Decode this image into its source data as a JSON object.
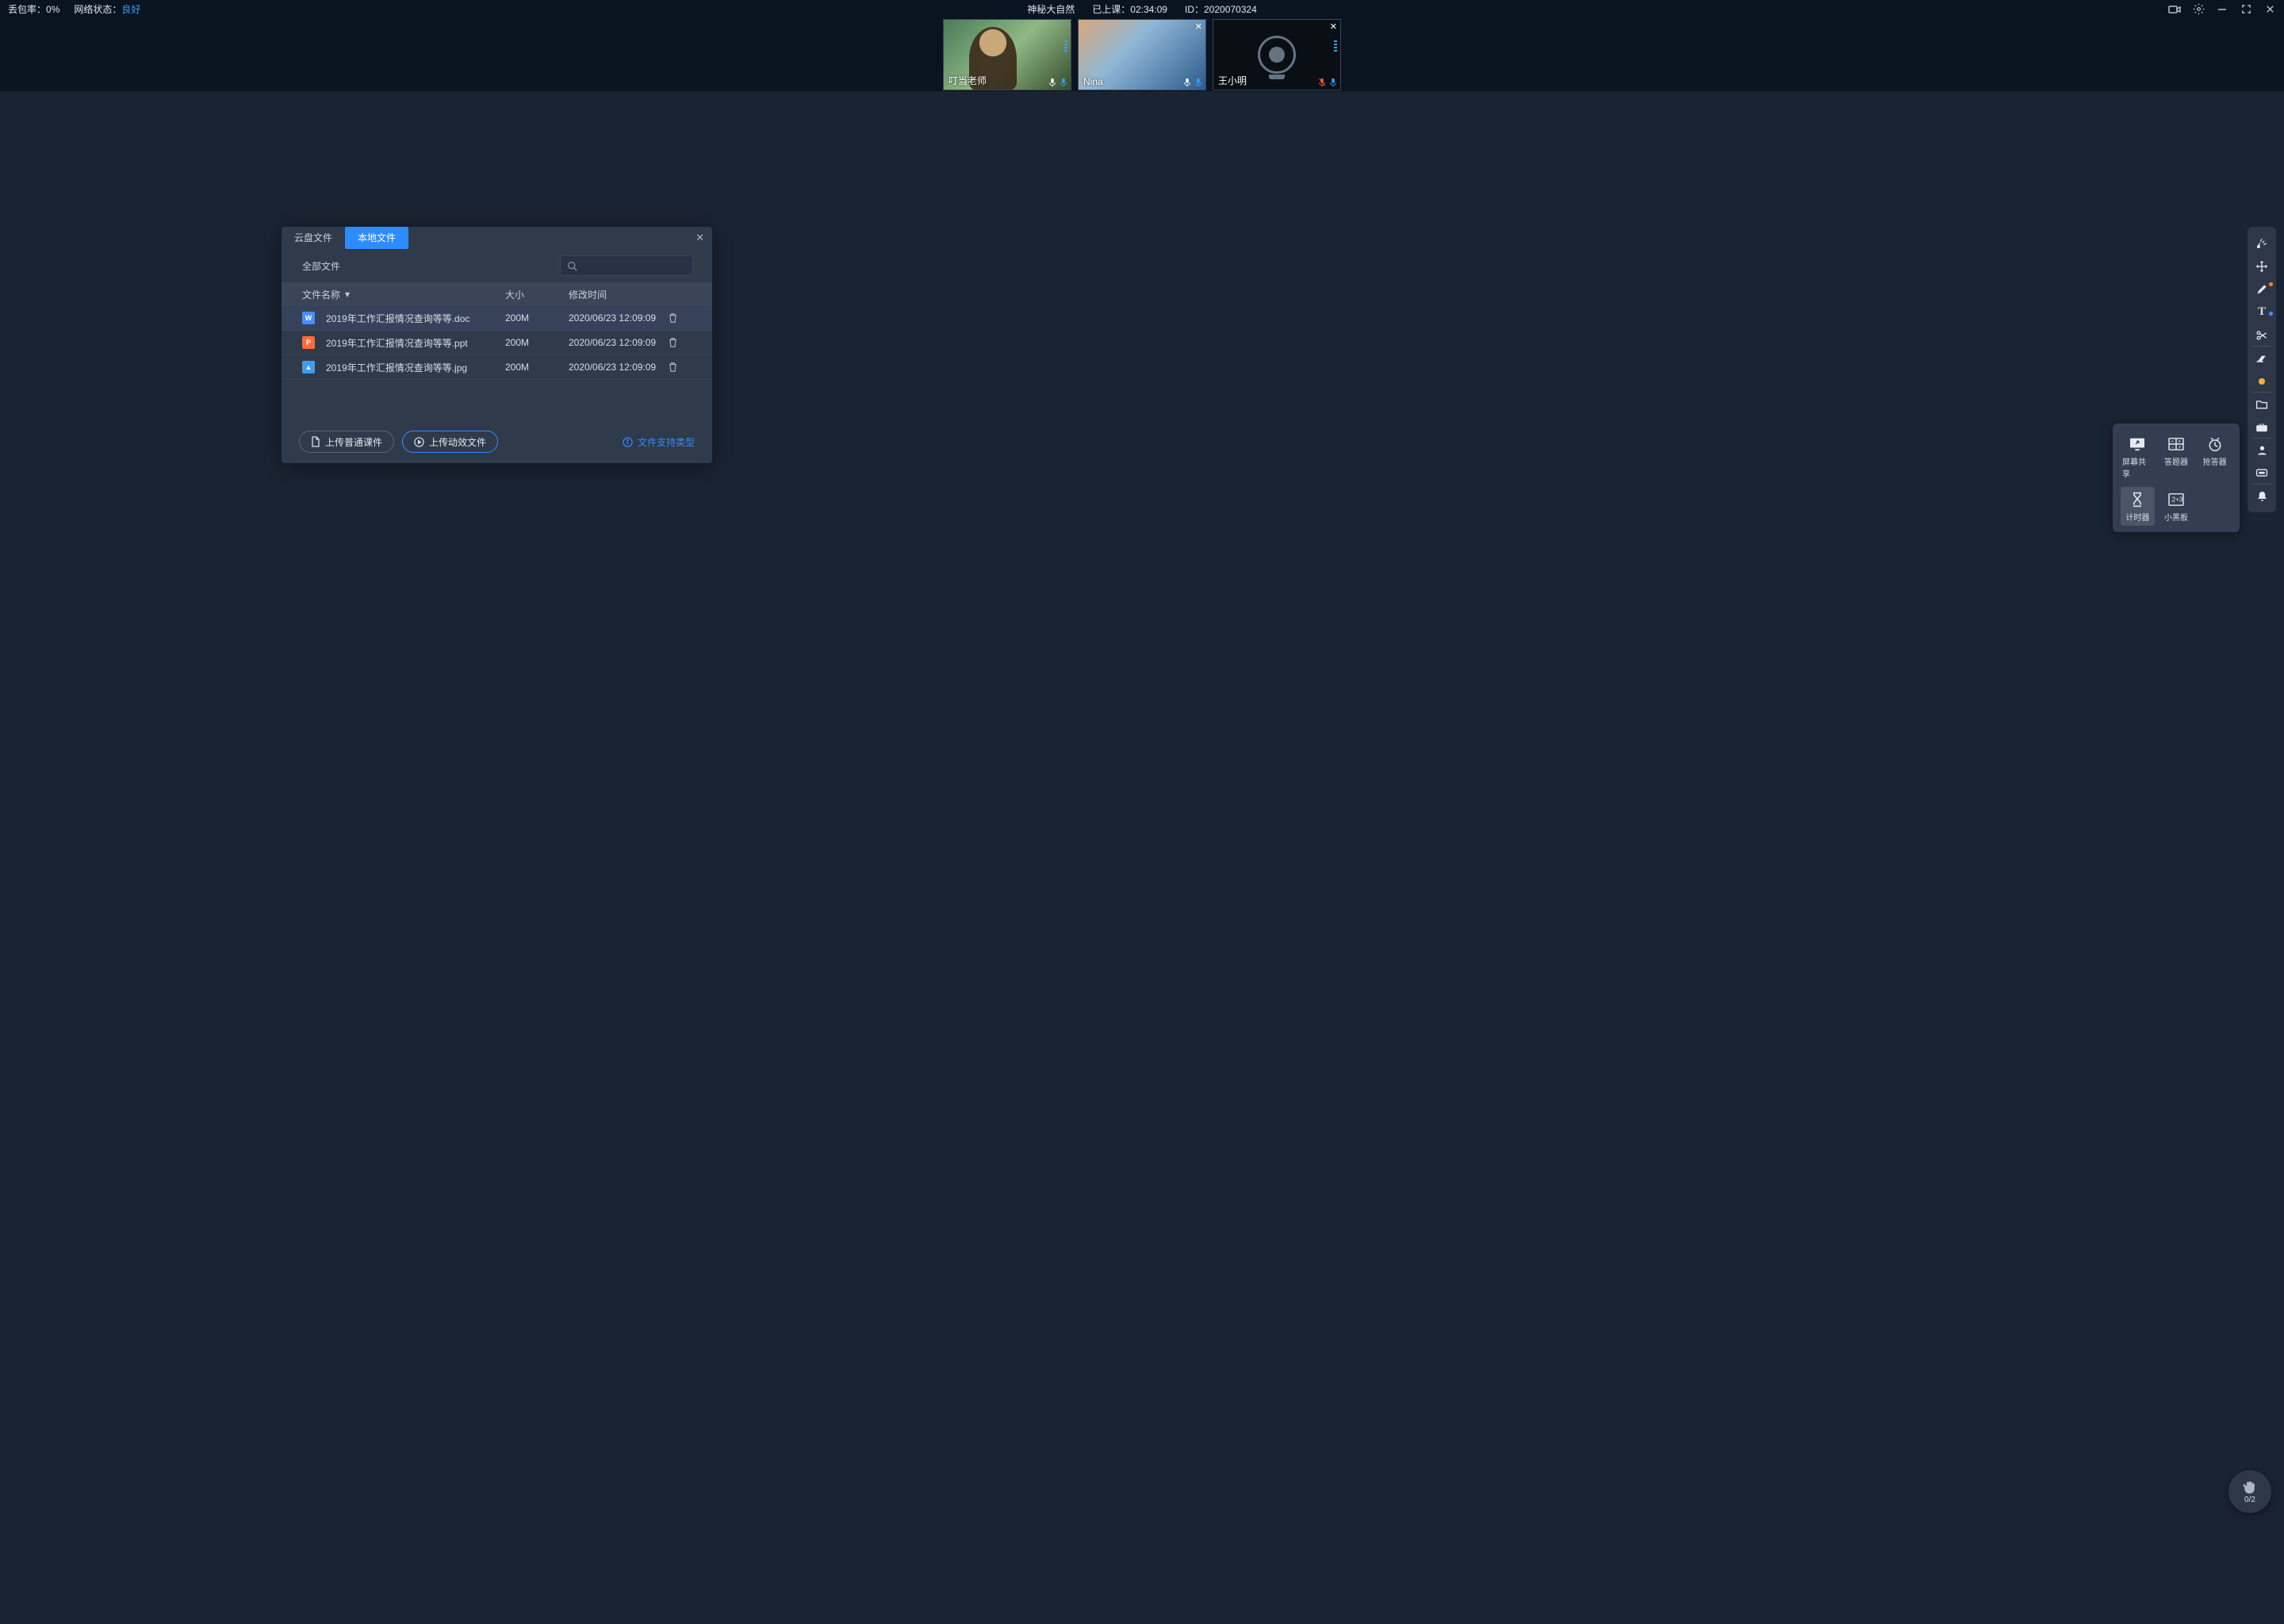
{
  "status": {
    "packetLossLabel": "丢包率：",
    "packetLossValue": "0%",
    "networkLabel": "网络状态：",
    "networkValue": "良好",
    "title": "神秘大自然",
    "elapsedLabel": "已上课：",
    "elapsedValue": "02:34:09",
    "idLabel": "ID：",
    "idValue": "2020070324"
  },
  "participants": [
    {
      "name": "叮当老师",
      "cameraOn": true,
      "micMuted": false,
      "closable": false
    },
    {
      "name": "Nina",
      "cameraOn": true,
      "micMuted": false,
      "closable": true
    },
    {
      "name": "王小明",
      "cameraOn": false,
      "micMuted": true,
      "closable": true
    }
  ],
  "dialog": {
    "tabs": {
      "cloud": "云盘文件",
      "local": "本地文件"
    },
    "filterLabel": "全部文件",
    "columns": {
      "name": "文件名称",
      "size": "大小",
      "time": "修改时间"
    },
    "files": [
      {
        "type": "doc",
        "badge": "W",
        "name": "2019年工作汇报情况查询等等.doc",
        "size": "200M",
        "time": "2020/06/23 12:09:09"
      },
      {
        "type": "ppt",
        "badge": "P",
        "name": "2019年工作汇报情况查询等等.ppt",
        "size": "200M",
        "time": "2020/06/23 12:09:09"
      },
      {
        "type": "jpg",
        "badge": "▲",
        "name": "2019年工作汇报情况查询等等.jpg",
        "size": "200M",
        "time": "2020/06/23 12:09:09"
      }
    ],
    "uploadNormal": "上传普通课件",
    "uploadAnimated": "上传动效文件",
    "supportLabel": "文件支持类型"
  },
  "sidebarTools": [
    "laser-icon",
    "move-icon",
    "pen-icon",
    "text-icon",
    "scissors-icon",
    "eraser-icon",
    "shapes-icon",
    "folder-icon",
    "toolbox-icon",
    "person-icon",
    "chat-icon",
    "bell-icon"
  ],
  "popoutTools": {
    "screenShare": "屏幕共享",
    "answerBoard": "答题器",
    "buzzer": "抢答器",
    "timer": "计时器",
    "smallBoard": "小黑板"
  },
  "raiseHand": {
    "count": "0/2"
  }
}
